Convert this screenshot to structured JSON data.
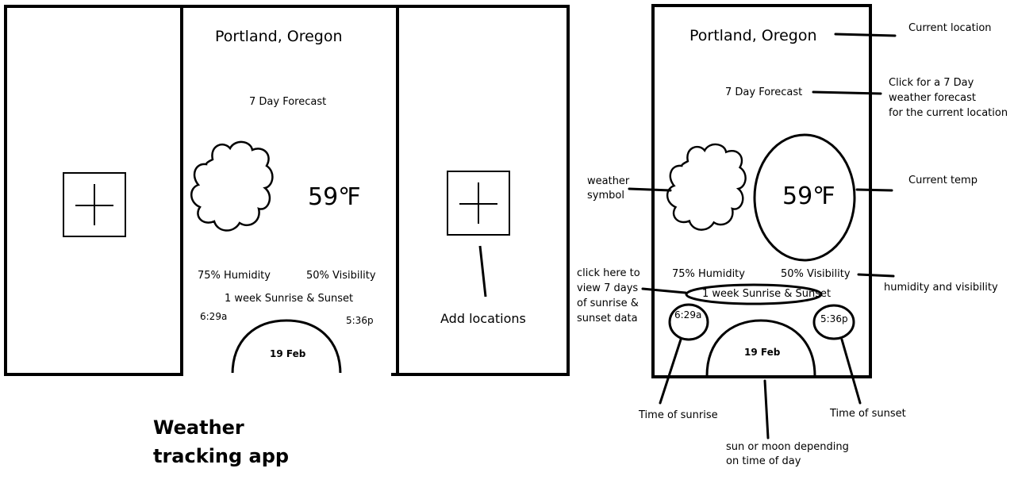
{
  "left_mockup": {
    "location": "Portland, Oregon",
    "forecast_link": "7 Day Forecast",
    "temperature": "59℉",
    "humidity": "75% Humidity",
    "visibility": "50% Visibility",
    "sunrise_sunset_link": "1 week Sunrise & Sunset",
    "sunrise_time": "6:29a",
    "sunset_time": "5:36p",
    "date": "19 Feb",
    "add_locations_label": "Add locations",
    "weather_icon": "cloud-icon",
    "add_icon": "plus-icon"
  },
  "app_caption": "Weather tracking app",
  "right_mockup": {
    "location": "Portland, Oregon",
    "forecast_link": "7 Day Forecast",
    "temperature": "59℉",
    "humidity": "75% Humidity",
    "visibility": "50% Visibility",
    "sunrise_sunset_link": "1 week Sunrise & Sunset",
    "sunrise_time": "6:29a",
    "sunset_time": "5:36p",
    "date": "19 Feb",
    "weather_icon": "cloud-icon"
  },
  "annotations": {
    "current_location": "Current location",
    "forecast": [
      "Click for a 7 Day",
      "weather forecast",
      "for the current location"
    ],
    "current_temp": "Current temp",
    "weather_symbol": [
      "weather",
      "symbol"
    ],
    "humidity_visibility": "humidity and visibility",
    "click_here": [
      "click here to",
      "view 7 days",
      "of sunrise &",
      "sunset data"
    ],
    "time_of_sunrise": "Time of sunrise",
    "time_of_sunset": "Time of sunset",
    "sun_or_moon": [
      "sun or moon depending",
      "on time of day"
    ]
  }
}
